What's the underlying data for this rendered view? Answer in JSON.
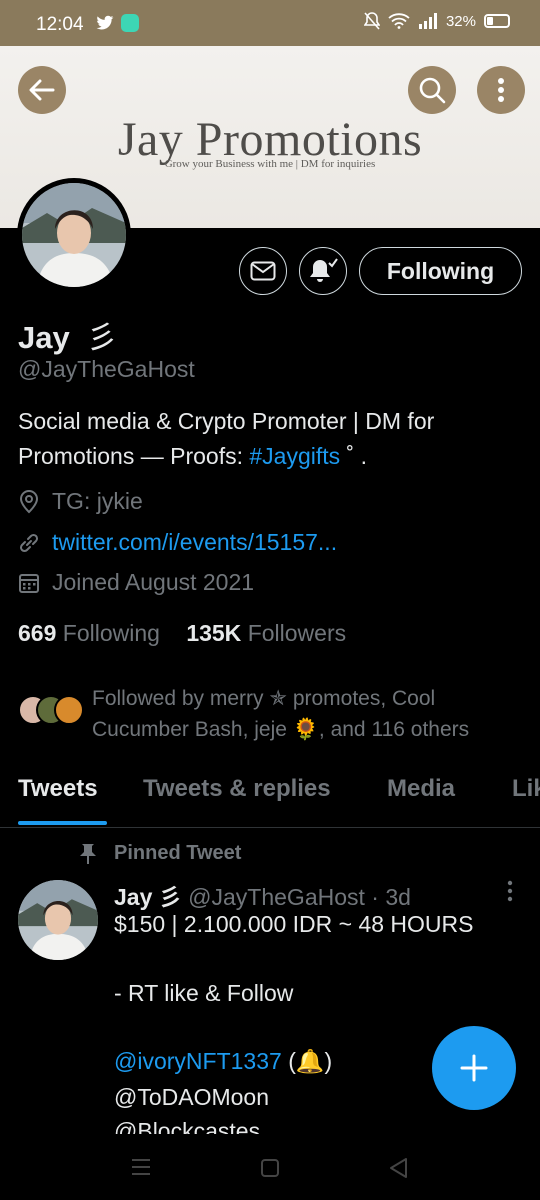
{
  "status_bar": {
    "time": "12:04",
    "battery": "32%",
    "icons": [
      "twitter-icon",
      "app-icon",
      "mute-icon",
      "wifi-icon",
      "signal-icon",
      "battery-icon"
    ]
  },
  "header": {
    "back_icon": "arrow-left-icon",
    "search_icon": "search-icon",
    "more_icon": "more-vertical-icon"
  },
  "banner": {
    "title": "Jay Promotions",
    "subtitle": "Grow your Business with me | DM for inquiries"
  },
  "profile": {
    "name": "Jay",
    "name_glyph": "彡",
    "handle": "@JayTheGaHost",
    "bio_text": "Social media & Crypto Promoter | DM for Promotions — Proofs: ",
    "bio_hashtag": "#Jaygifts",
    "bio_tail": " ˚ .",
    "location": "TG: jykie",
    "url": "twitter.com/i/events/15157...",
    "joined": "Joined August 2021",
    "following_count": "669",
    "following_label": "Following",
    "followers_count": "135K",
    "followers_label": "Followers",
    "followed_by": "Followed by merry ✯ promotes, Cool Cucumber Bash, jeje 🌻, and 116 others"
  },
  "actions": {
    "message_icon": "mail-icon",
    "notify_icon": "bell-check-icon",
    "follow_label": "Following"
  },
  "tabs": [
    {
      "label": "Tweets",
      "active": true
    },
    {
      "label": "Tweets & replies",
      "active": false
    },
    {
      "label": "Media",
      "active": false
    },
    {
      "label": "Lik",
      "active": false
    }
  ],
  "pinned_tweet": {
    "pinned_label": "Pinned Tweet",
    "author": "Jay 彡",
    "handle_time": "@JayTheGaHost · 3d",
    "lines": [
      "$150 | 2.100.000 IDR ~ 48 HOURS",
      "- RT like & Follow",
      "@ivoryNFT1337",
      "@ToDAOMoon",
      "@Blockcastes"
    ],
    "bell_suffix": "(🔔)"
  },
  "fab": {
    "icon": "plus-icon"
  },
  "nav": {
    "icons": [
      "recents-icon",
      "home-icon",
      "back-icon"
    ]
  },
  "colors": {
    "accent": "#1d9bf0",
    "background": "#000000",
    "muted": "#71767b",
    "status_bar": "#8a7a5c"
  }
}
